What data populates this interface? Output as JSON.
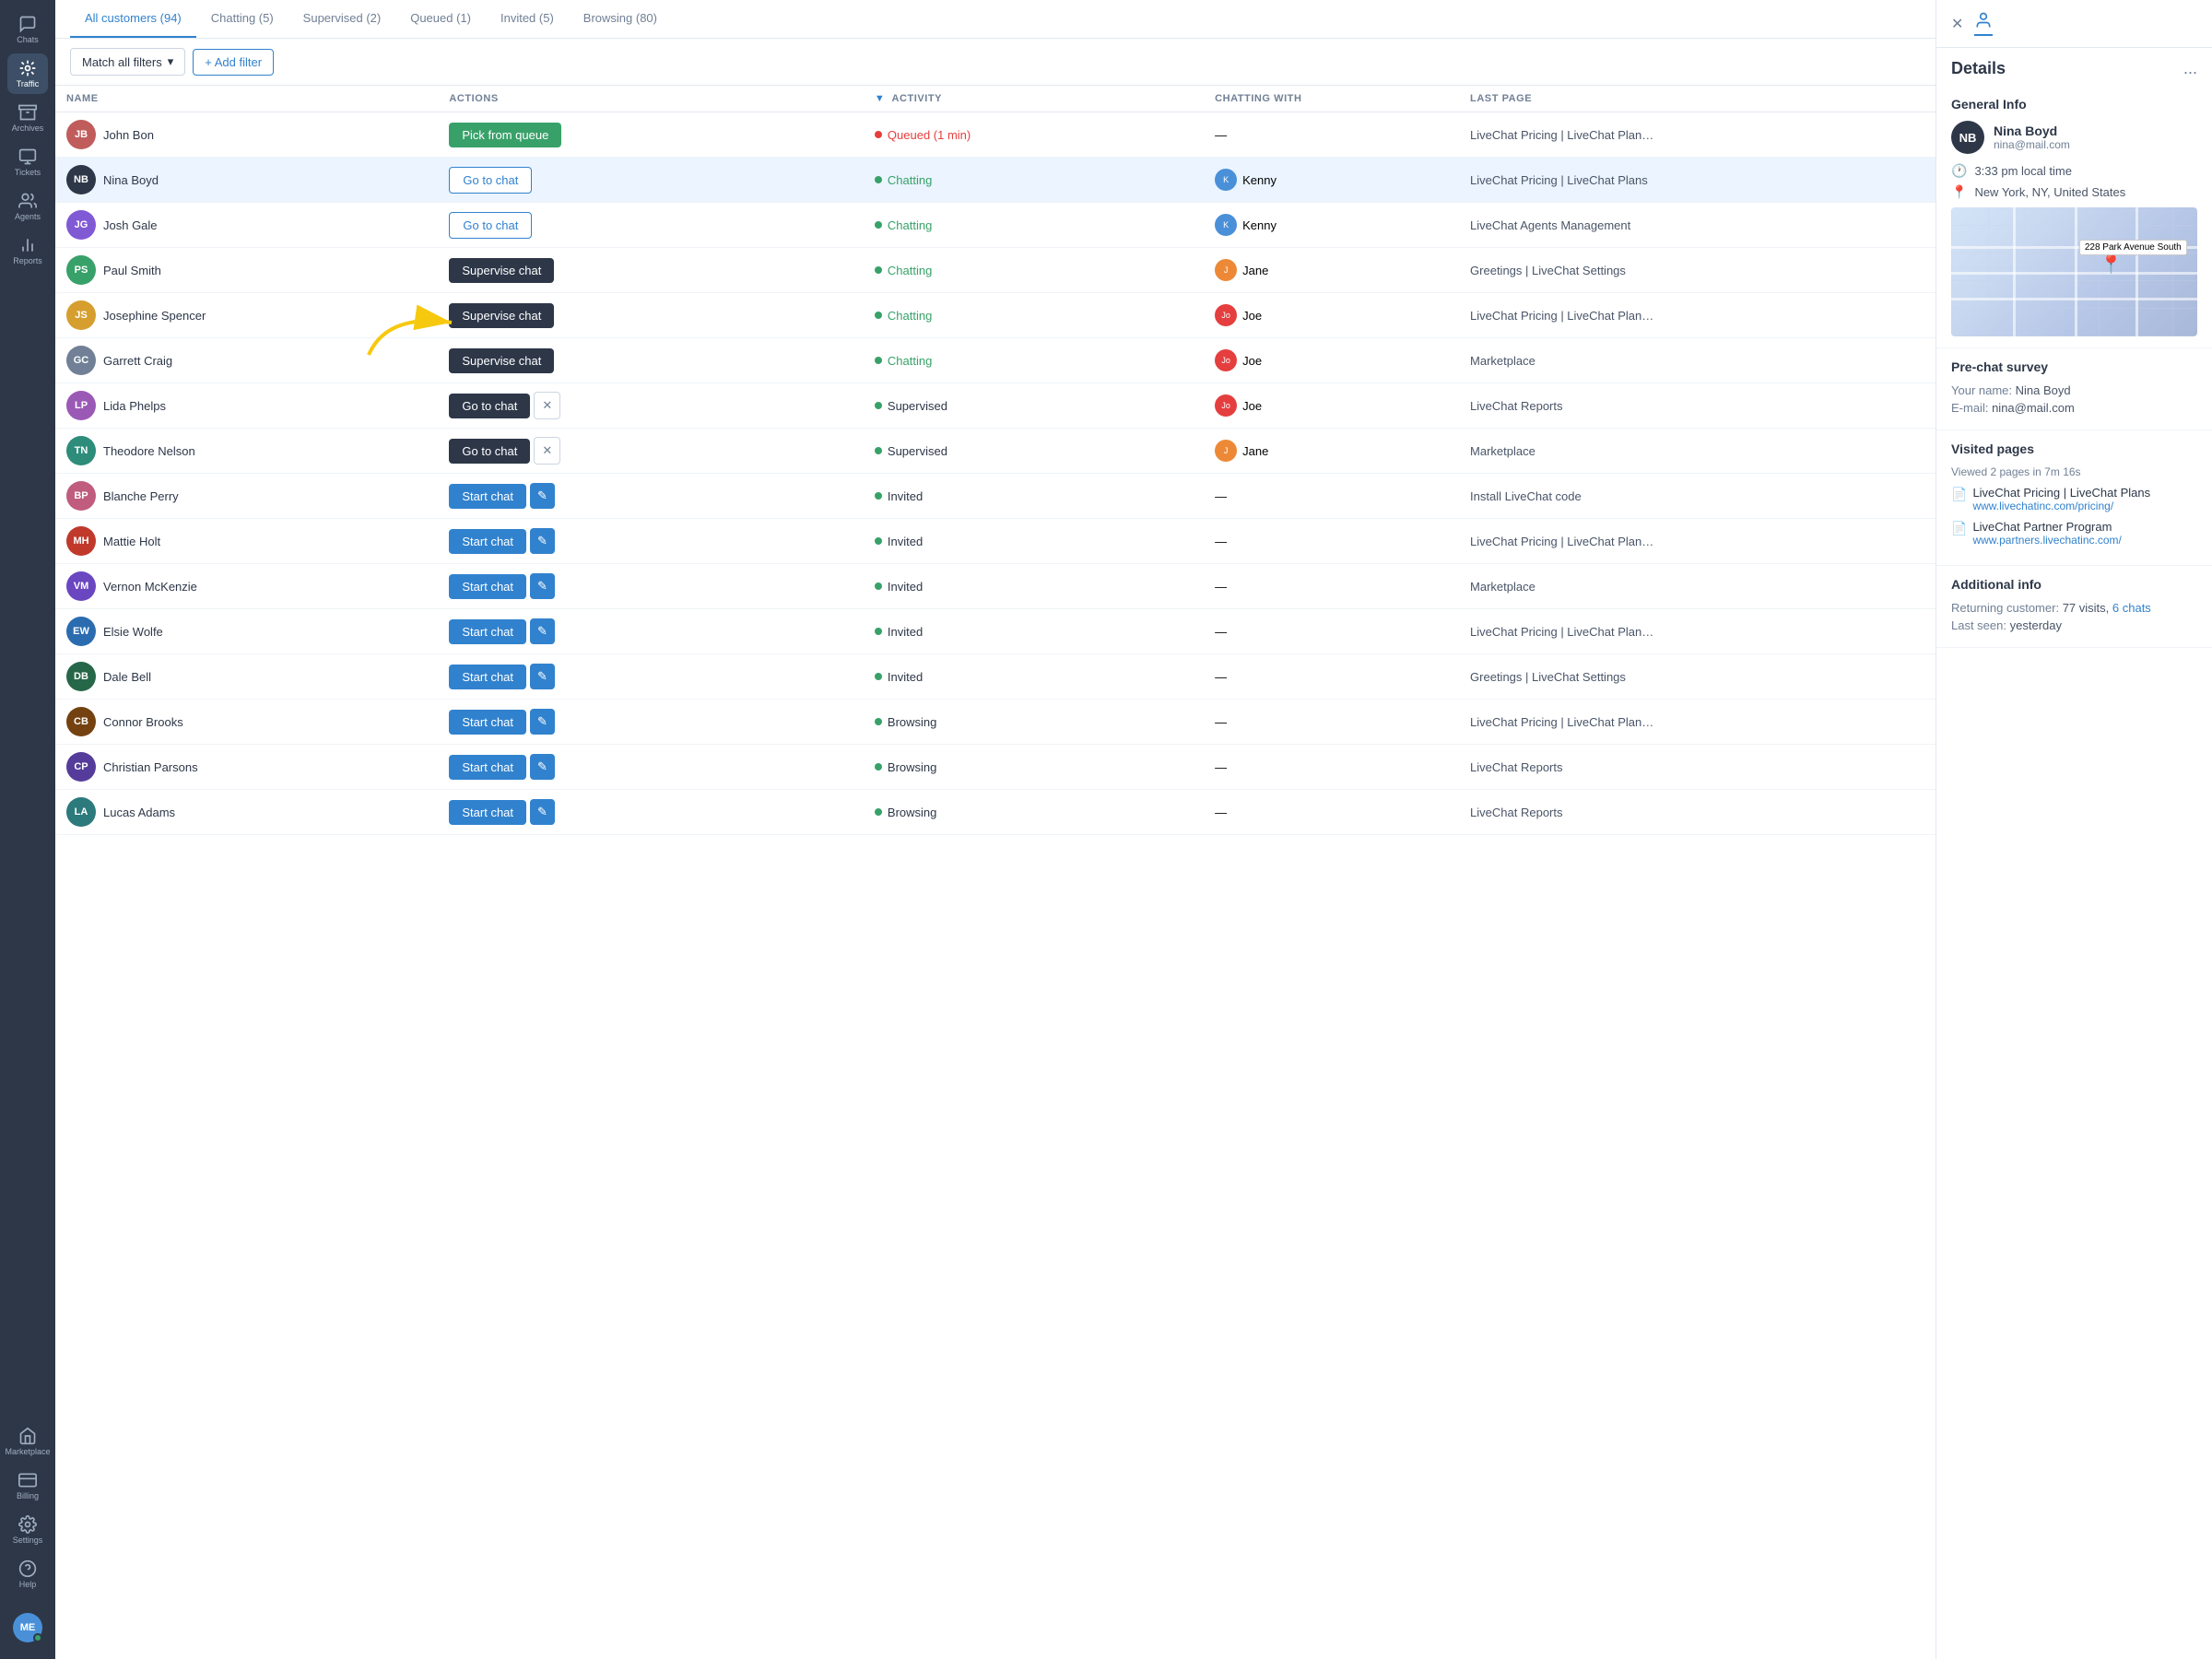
{
  "sidebar": {
    "items": [
      {
        "label": "Chats",
        "icon": "chat"
      },
      {
        "label": "Traffic",
        "icon": "traffic",
        "active": true
      },
      {
        "label": "Archives",
        "icon": "archives"
      },
      {
        "label": "Tickets",
        "icon": "tickets"
      },
      {
        "label": "Agents",
        "icon": "agents"
      },
      {
        "label": "Reports",
        "icon": "reports"
      },
      {
        "label": "Marketplace",
        "icon": "marketplace"
      },
      {
        "label": "Billing",
        "icon": "billing"
      },
      {
        "label": "Settings",
        "icon": "settings"
      },
      {
        "label": "Help",
        "icon": "help"
      }
    ]
  },
  "tabs": [
    {
      "label": "All customers (94)",
      "active": true
    },
    {
      "label": "Chatting (5)",
      "active": false
    },
    {
      "label": "Supervised (2)",
      "active": false
    },
    {
      "label": "Queued (1)",
      "active": false
    },
    {
      "label": "Invited (5)",
      "active": false
    },
    {
      "label": "Browsing (80)",
      "active": false
    }
  ],
  "toolbar": {
    "filter_label": "Match all filters",
    "add_filter_label": "+ Add filter"
  },
  "table": {
    "columns": [
      "NAME",
      "ACTIONS",
      "ACTIVITY",
      "CHATTING WITH",
      "LAST PAGE"
    ],
    "rows": [
      {
        "initials": "JB",
        "name": "John Bon",
        "avatar_color": "#c05c5c",
        "action": "Pick from queue",
        "action_type": "pick",
        "status_type": "queued",
        "status_dot": "queued",
        "activity": "Queued (1 min)",
        "chatting_with": "—",
        "last_page": "LiveChat Pricing | LiveChat Plans - Cu"
      },
      {
        "initials": "NB",
        "name": "Nina Boyd",
        "avatar_color": "#2d3748",
        "action": "Go to chat",
        "action_type": "goto-outline",
        "status_type": "chatting",
        "status_dot": "chatting",
        "activity": "Chatting",
        "chatting_with": "Kenny",
        "chatting_with_avatar": "#4a90d9",
        "chatting_with_initials": "K",
        "last_page": "LiveChat Pricing | LiveChat Plans",
        "selected": true
      },
      {
        "initials": "JG",
        "name": "Josh Gale",
        "avatar_color": "#805ad5",
        "action": "Go to chat",
        "action_type": "goto-outline",
        "status_type": "chatting",
        "status_dot": "chatting",
        "activity": "Chatting",
        "chatting_with": "Kenny",
        "chatting_with_avatar": "#4a90d9",
        "chatting_with_initials": "K",
        "last_page": "LiveChat Agents Management"
      },
      {
        "initials": "PS",
        "name": "Paul Smith",
        "avatar_color": "#38a169",
        "action": "Supervise chat",
        "action_type": "supervise",
        "status_type": "chatting",
        "status_dot": "chatting",
        "activity": "Chatting",
        "chatting_with": "Jane",
        "chatting_with_avatar": "#ed8936",
        "chatting_with_initials": "J",
        "last_page": "Greetings | LiveChat Settings"
      },
      {
        "initials": "JS",
        "name": "Josephine Spencer",
        "avatar_color": "#d69e2e",
        "action": "Supervise chat",
        "action_type": "supervise",
        "status_type": "chatting",
        "status_dot": "chatting",
        "activity": "Chatting",
        "chatting_with": "Joe",
        "chatting_with_avatar": "#e53e3e",
        "chatting_with_initials": "Jo",
        "last_page": "LiveChat Pricing | LiveChat Plans - Cu",
        "annotated": true
      },
      {
        "initials": "GC",
        "name": "Garrett Craig",
        "avatar_color": "#718096",
        "action": "Supervise chat",
        "action_type": "supervise",
        "status_type": "chatting",
        "status_dot": "chatting",
        "activity": "Chatting",
        "chatting_with": "Joe",
        "chatting_with_avatar": "#e53e3e",
        "chatting_with_initials": "Jo",
        "last_page": "Marketplace"
      },
      {
        "initials": "LP",
        "name": "Lida Phelps",
        "avatar_color": "#9b59b6",
        "action": "Go to chat",
        "action_type": "goto-dark",
        "show_x": true,
        "status_type": "supervised",
        "status_dot": "supervised",
        "activity": "Supervised",
        "chatting_with": "Joe",
        "chatting_with_avatar": "#e53e3e",
        "chatting_with_initials": "Jo",
        "last_page": "LiveChat Reports"
      },
      {
        "initials": "TN",
        "name": "Theodore Nelson",
        "avatar_color": "#2d8c7a",
        "action": "Go to chat",
        "action_type": "goto-dark",
        "show_x": true,
        "status_type": "supervised",
        "status_dot": "supervised",
        "activity": "Supervised",
        "chatting_with": "Jane",
        "chatting_with_avatar": "#ed8936",
        "chatting_with_initials": "J",
        "last_page": "Marketplace"
      },
      {
        "initials": "BP",
        "name": "Blanche Perry",
        "avatar_color": "#c05c7e",
        "action": "Start chat",
        "action_type": "start",
        "show_edit": true,
        "status_type": "invited",
        "status_dot": "invited",
        "activity": "Invited",
        "chatting_with": "—",
        "last_page": "Install LiveChat code"
      },
      {
        "initials": "MH",
        "name": "Mattie Holt",
        "avatar_color": "#c0392b",
        "action": "Start chat",
        "action_type": "start",
        "show_edit": true,
        "status_type": "invited",
        "status_dot": "invited",
        "activity": "Invited",
        "chatting_with": "—",
        "last_page": "LiveChat Pricing | LiveChat Plans - Cu"
      },
      {
        "initials": "VM",
        "name": "Vernon McKenzie",
        "avatar_color": "#6b46c1",
        "action": "Start chat",
        "action_type": "start",
        "show_edit": true,
        "status_type": "invited",
        "status_dot": "invited",
        "activity": "Invited",
        "chatting_with": "—",
        "last_page": "Marketplace"
      },
      {
        "initials": "EW",
        "name": "Elsie Wolfe",
        "avatar_color": "#2b6cb0",
        "action": "Start chat",
        "action_type": "start",
        "show_edit": true,
        "status_type": "invited",
        "status_dot": "invited",
        "activity": "Invited",
        "chatting_with": "—",
        "last_page": "LiveChat Pricing | LiveChat Plans - Cu"
      },
      {
        "initials": "DB",
        "name": "Dale Bell",
        "avatar_color": "#276749",
        "action": "Start chat",
        "action_type": "start",
        "show_edit": true,
        "status_type": "invited",
        "status_dot": "invited",
        "activity": "Invited",
        "chatting_with": "—",
        "last_page": "Greetings | LiveChat Settings"
      },
      {
        "initials": "CB",
        "name": "Connor Brooks",
        "avatar_color": "#744210",
        "action": "Start chat",
        "action_type": "start",
        "show_edit": true,
        "status_type": "browsing",
        "status_dot": "browsing",
        "activity": "Browsing",
        "chatting_with": "—",
        "last_page": "LiveChat Pricing | LiveChat Plans - Cu"
      },
      {
        "initials": "CP",
        "name": "Christian Parsons",
        "avatar_color": "#553c9a",
        "action": "Start chat",
        "action_type": "start",
        "show_edit": true,
        "status_type": "browsing",
        "status_dot": "browsing",
        "activity": "Browsing",
        "chatting_with": "—",
        "last_page": "LiveChat Reports"
      },
      {
        "initials": "LA",
        "name": "Lucas Adams",
        "avatar_color": "#2c7a7b",
        "action": "Start chat",
        "action_type": "start",
        "show_edit": true,
        "status_type": "browsing",
        "status_dot": "browsing",
        "activity": "Browsing",
        "chatting_with": "—",
        "last_page": "LiveChat Reports"
      }
    ]
  },
  "panel": {
    "title": "Details",
    "more_icon": "...",
    "general_info": {
      "section_title": "General Info",
      "user_initials": "NB",
      "user_name": "Nina Boyd",
      "user_email": "nina@mail.com",
      "local_time": "3:33 pm local time",
      "location": "New York, NY, United States",
      "map_label": "228 Park Avenue South"
    },
    "pre_chat_survey": {
      "section_title": "Pre-chat survey",
      "name_label": "Your name:",
      "name_value": "Nina Boyd",
      "email_label": "E-mail:",
      "email_value": "nina@mail.com"
    },
    "visited_pages": {
      "section_title": "Visited pages",
      "subtitle": "Viewed 2 pages in 7m 16s",
      "pages": [
        {
          "title": "LiveChat Pricing | LiveChat Plans",
          "url": "www.livechatinc.com/pricing/"
        },
        {
          "title": "LiveChat Partner Program",
          "url": "www.partners.livechatinc.com/"
        }
      ]
    },
    "additional_info": {
      "section_title": "Additional info",
      "returning_label": "Returning customer:",
      "returning_visits": "77 visits,",
      "returning_chats": "6 chats",
      "last_seen_label": "Last seen:",
      "last_seen_value": "yesterday"
    }
  }
}
